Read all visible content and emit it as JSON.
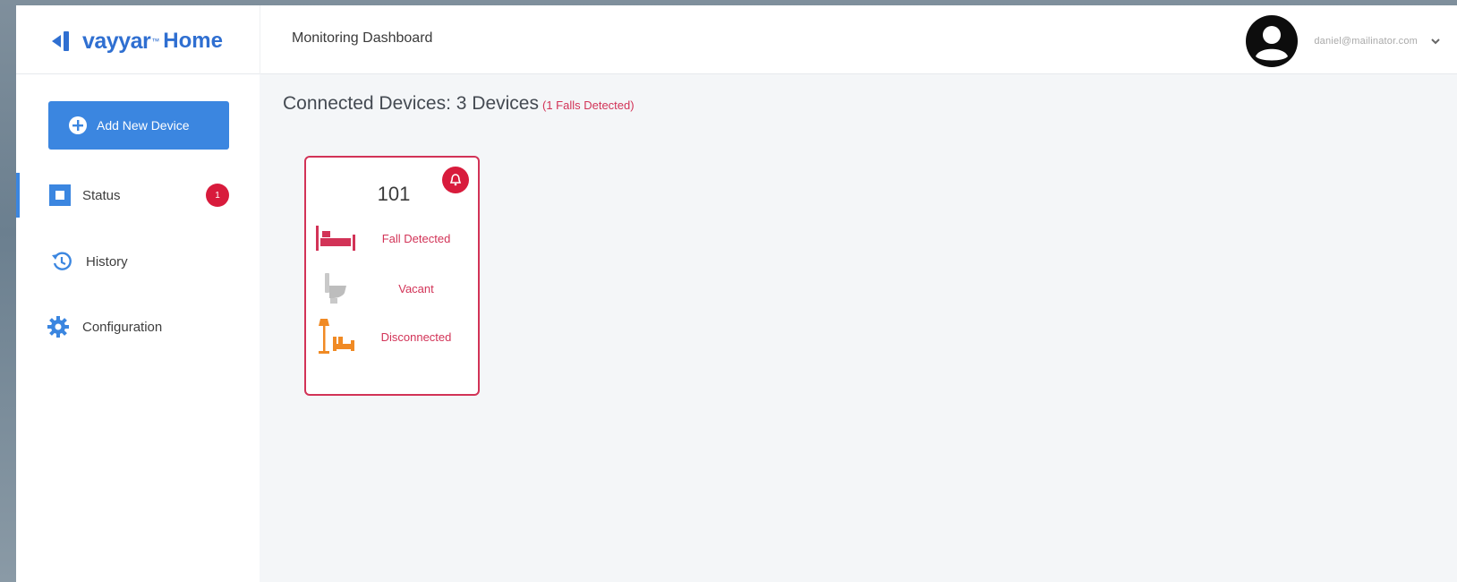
{
  "brand": {
    "name": "vayyar",
    "product": "Home",
    "color": "#2f6fd1"
  },
  "header": {
    "title": "Monitoring Dashboard"
  },
  "user": {
    "email": "daniel@mailinator.com",
    "avatar_icon": "user-circle-icon"
  },
  "sidebar": {
    "add_button": {
      "label": "Add New Device",
      "icon": "plus-circle-icon"
    },
    "items": [
      {
        "label": "Status",
        "icon": "status-square-icon",
        "badge": "1",
        "active": true
      },
      {
        "label": "History",
        "icon": "history-icon"
      },
      {
        "label": "Configuration",
        "icon": "gear-icon"
      }
    ]
  },
  "main": {
    "heading": "Connected Devices: 3 Devices",
    "falls_note": "(1 Falls Detected)"
  },
  "devices": [
    {
      "name": "101",
      "alert_icon": "bell-alert-icon",
      "rooms": [
        {
          "icon": "bed-icon",
          "status": "Fall Detected"
        },
        {
          "icon": "toilet-icon",
          "status": "Vacant"
        },
        {
          "icon": "lamp-sofa-icon",
          "status": "Disconnected"
        }
      ]
    }
  ],
  "colors": {
    "accent": "#3b86e0",
    "alert": "#d81b3c",
    "alert_text": "#d23357",
    "warning": "#f08a24"
  }
}
